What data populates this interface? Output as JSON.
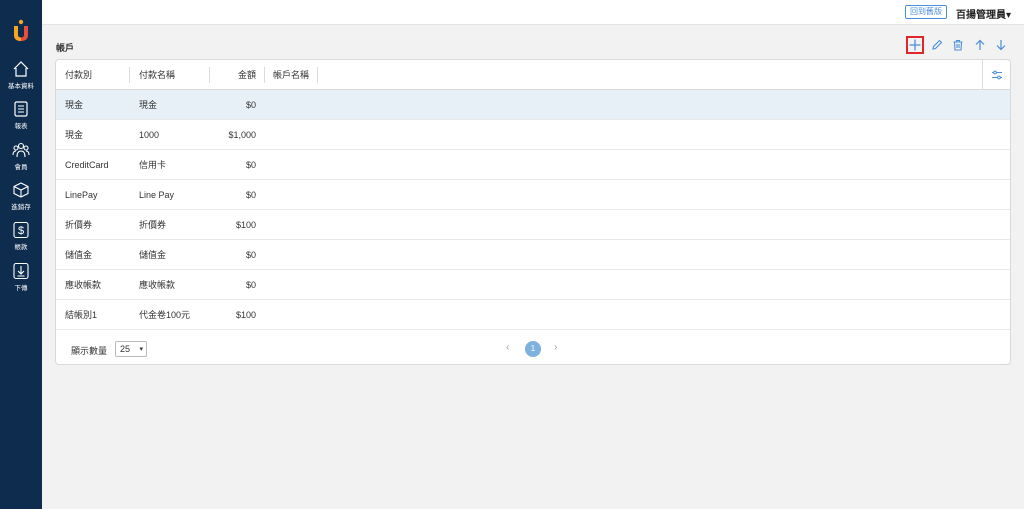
{
  "sidebar": {
    "items": [
      {
        "label": "基本資料",
        "icon": "home-icon"
      },
      {
        "label": "報表",
        "icon": "report-icon"
      },
      {
        "label": "會員",
        "icon": "members-icon"
      },
      {
        "label": "進銷存",
        "icon": "inventory-box-icon"
      },
      {
        "label": "帳款",
        "icon": "dollar-icon"
      },
      {
        "label": "下傳",
        "icon": "download-icon"
      }
    ]
  },
  "header": {
    "back_label": "回到舊版",
    "user_name": "百揚管理員",
    "user_caret": "▾"
  },
  "page": {
    "title": "帳戶"
  },
  "toolbar": {
    "add": "plus-icon",
    "edit": "pencil-icon",
    "delete": "trash-icon",
    "up": "arrow-up-icon",
    "down": "arrow-down-icon"
  },
  "table": {
    "columns": [
      "付款別",
      "付款名稱",
      "金額",
      "帳戶名稱"
    ],
    "rows": [
      {
        "type": "現金",
        "name": "現金",
        "amount": "$0",
        "account": ""
      },
      {
        "type": "現金",
        "name": "1000",
        "amount": "$1,000",
        "account": ""
      },
      {
        "type": "CreditCard",
        "name": "信用卡",
        "amount": "$0",
        "account": ""
      },
      {
        "type": "LinePay",
        "name": "Line Pay",
        "amount": "$0",
        "account": ""
      },
      {
        "type": "折價券",
        "name": "折價券",
        "amount": "$100",
        "account": ""
      },
      {
        "type": "儲值金",
        "name": "儲值金",
        "amount": "$0",
        "account": ""
      },
      {
        "type": "應收帳款",
        "name": "應收帳款",
        "amount": "$0",
        "account": ""
      },
      {
        "type": "結帳別1",
        "name": "代金卷100元",
        "amount": "$100",
        "account": ""
      }
    ]
  },
  "footer": {
    "page_size_label": "顯示數量",
    "page_size": "25",
    "current_page": "1",
    "prev": "‹",
    "next": "›"
  },
  "colors": {
    "sidebar": "#0e2c4d",
    "accent": "#4a90d9",
    "selected_row": "#e8f0f7",
    "highlight": "#e0262c"
  }
}
